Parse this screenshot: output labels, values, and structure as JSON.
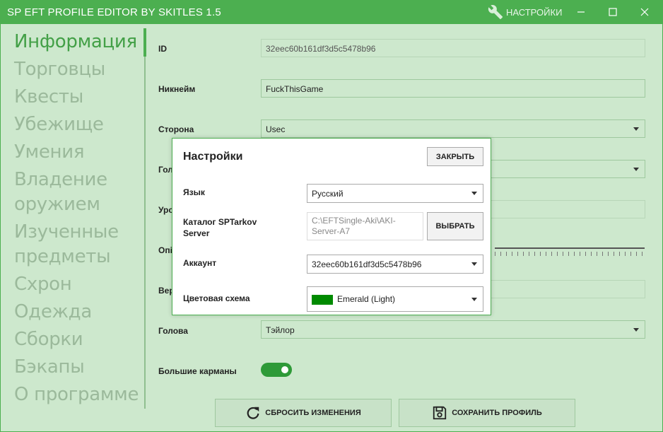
{
  "app": {
    "title": "SP EFT PROFILE EDITOR BY SKITLES 1.5",
    "settings_label": "НАСТРОЙКИ",
    "accent_color": "#4caf50"
  },
  "nav": {
    "items": [
      "Информация",
      "Торговцы",
      "Квесты",
      "Убежище",
      "Умения",
      "Владение оружием",
      "Изученные предметы",
      "Схрон",
      "Одежда",
      "Сборки",
      "Бэкапы",
      "О программе"
    ],
    "active": "Информация"
  },
  "info": {
    "id_label": "ID",
    "id_value": "32eec60b161df3d5c5478b96",
    "nickname_label": "Никнейм",
    "nickname_value": "FuckThisGame",
    "side_label": "Сторона",
    "side_value": "Usec",
    "voice_label_partial": "Гол",
    "level_label_partial": "Уро",
    "exp_label_partial": "Опі",
    "version_label_partial": "Вер",
    "head_label": "Голова",
    "head_value": "Тэйлор",
    "pockets_label": "Большие карманы",
    "pockets_enabled": true
  },
  "actions": {
    "reset_label": "СБРОСИТЬ ИЗМЕНЕНИЯ",
    "save_label": "СОХРАНИТЬ ПРОФИЛЬ"
  },
  "settings_dialog": {
    "title": "Настройки",
    "close_label": "ЗАКРЫТЬ",
    "language_label": "Язык",
    "language_value": "Русский",
    "server_label_line1": "Каталог SPTarkov",
    "server_label_line2": "Server",
    "server_path_line1": "C:\\EFTSingle-Aki\\AKI-",
    "server_path_line2": "Server-A7",
    "browse_label": "ВЫБРАТЬ",
    "account_label": "Аккаунт",
    "account_value": "32eec60b161df3d5c5478b96",
    "scheme_label": "Цветовая схема",
    "scheme_value": "Emerald (Light)",
    "scheme_color": "#008a00"
  }
}
